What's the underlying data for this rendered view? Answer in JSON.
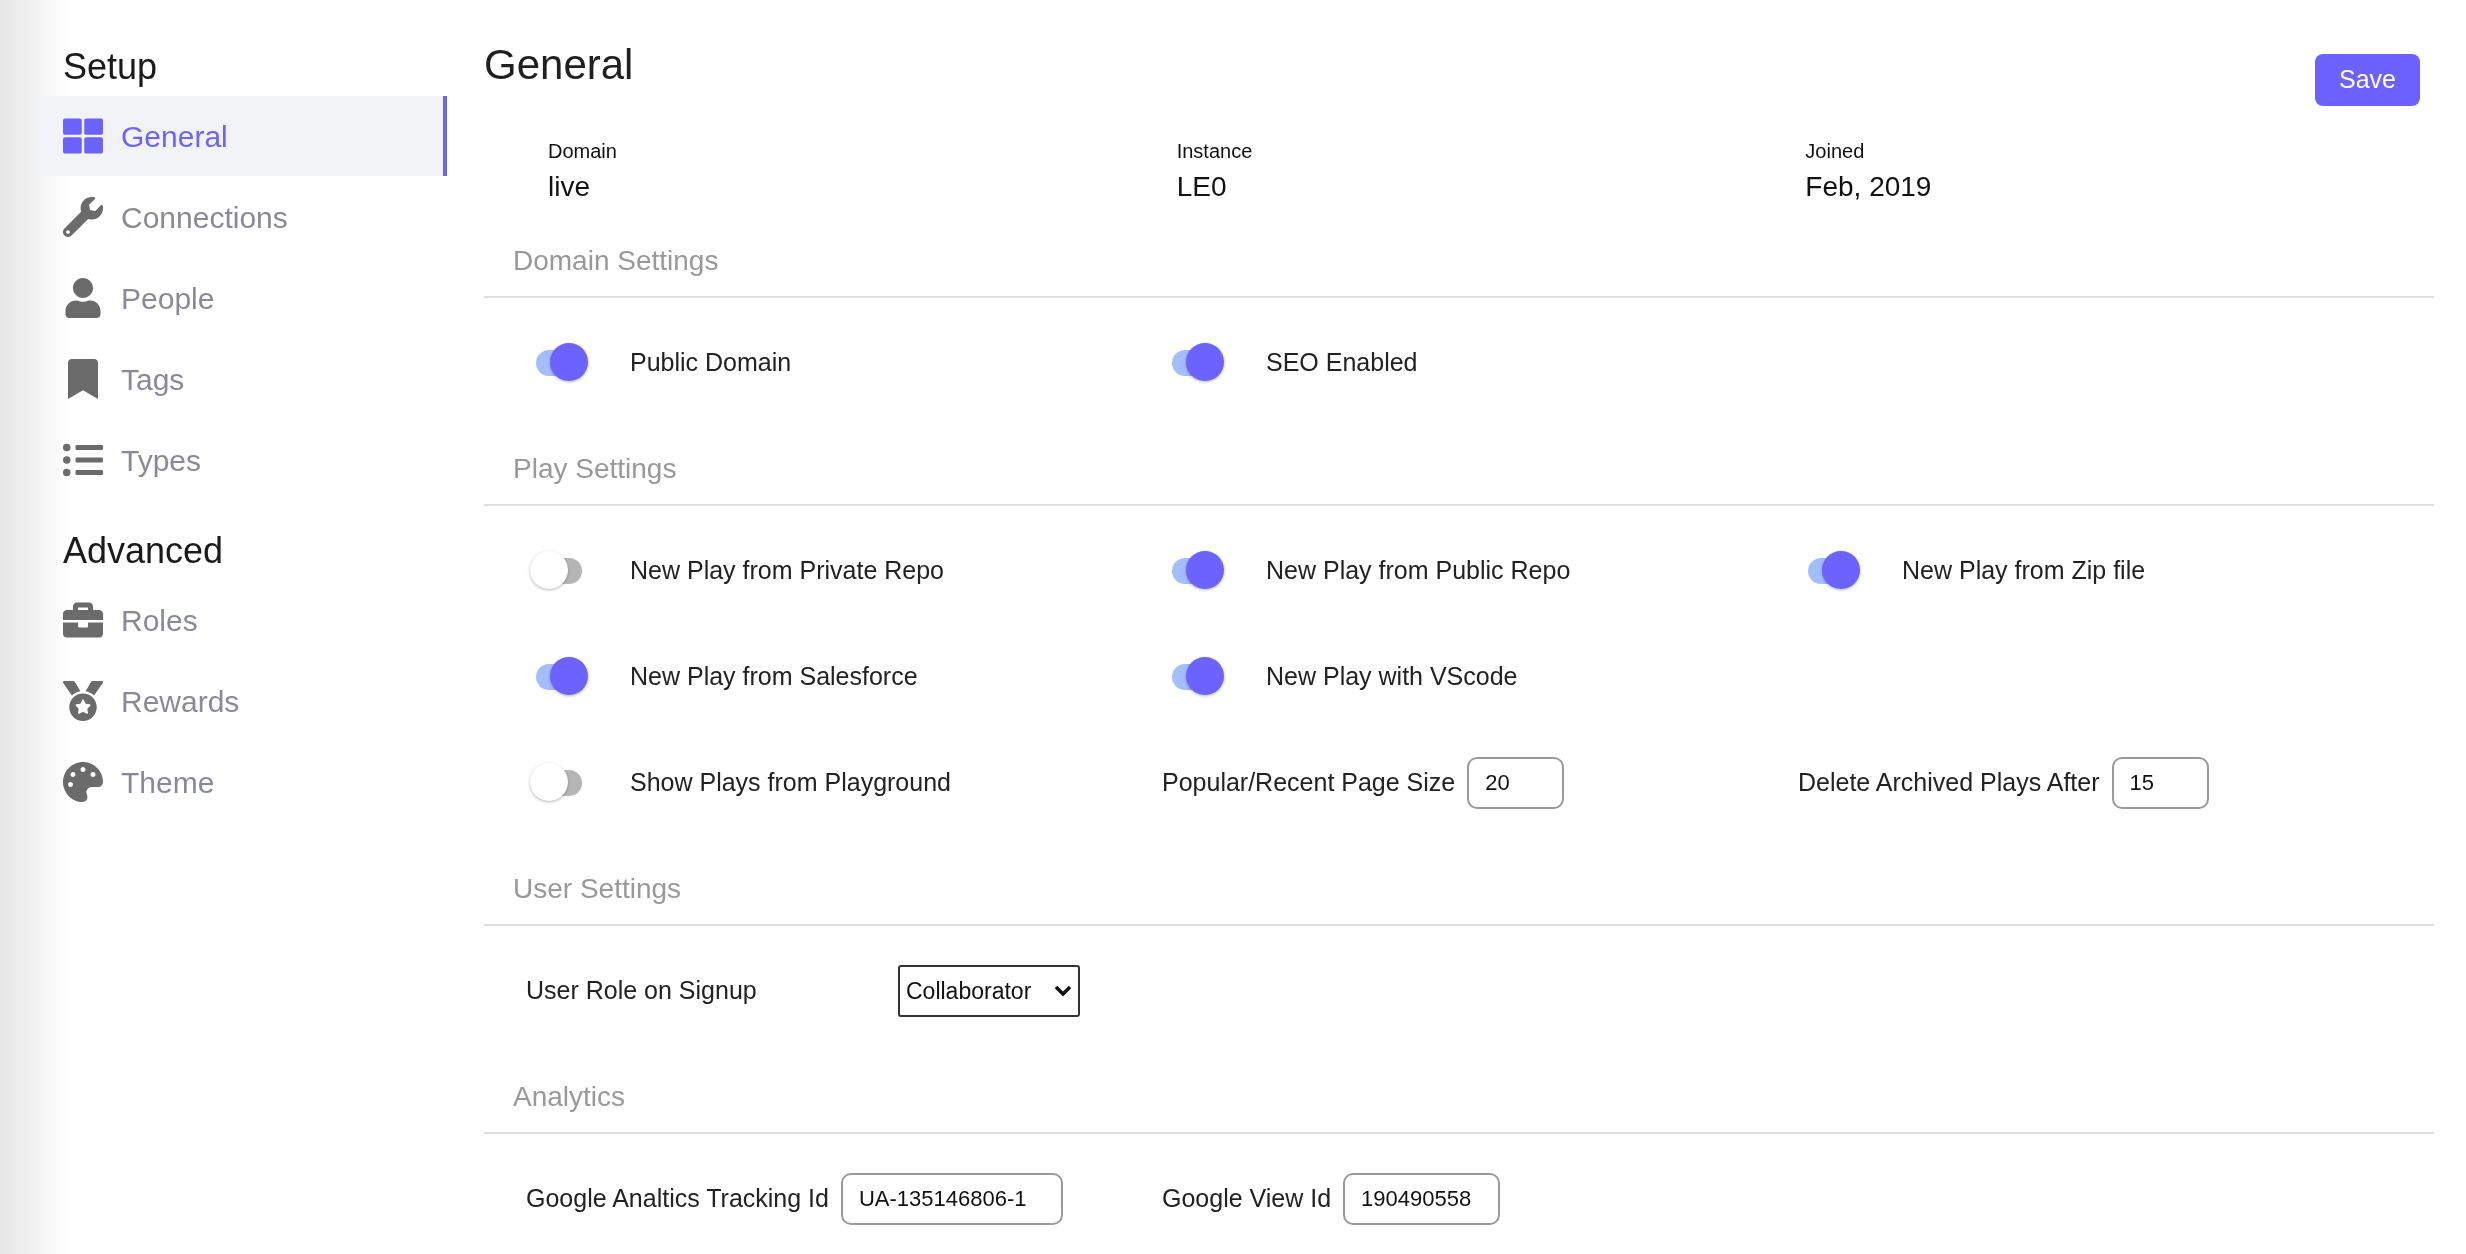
{
  "sidebar": {
    "groups": [
      {
        "title": "Setup",
        "items": [
          {
            "label": "General",
            "selected": true
          },
          {
            "label": "Connections",
            "selected": false
          },
          {
            "label": "People",
            "selected": false
          },
          {
            "label": "Tags",
            "selected": false
          },
          {
            "label": "Types",
            "selected": false
          }
        ]
      },
      {
        "title": "Advanced",
        "items": [
          {
            "label": "Roles",
            "selected": false
          },
          {
            "label": "Rewards",
            "selected": false
          },
          {
            "label": "Theme",
            "selected": false
          }
        ]
      }
    ]
  },
  "page": {
    "title": "General",
    "save_button": "Save",
    "info": [
      {
        "label": "Domain",
        "value": "live"
      },
      {
        "label": "Instance",
        "value": "LE0"
      },
      {
        "label": "Joined",
        "value": "Feb, 2019"
      }
    ]
  },
  "sections": [
    {
      "title": "Domain Settings",
      "rows": [
        [
          {
            "kind": "toggle",
            "label": "Public Domain",
            "on": true
          },
          {
            "kind": "toggle",
            "label": "SEO Enabled",
            "on": true
          }
        ]
      ]
    },
    {
      "title": "Play Settings",
      "rows": [
        [
          {
            "kind": "toggle",
            "label": "New Play from Private Repo",
            "on": false
          },
          {
            "kind": "toggle",
            "label": "New Play from Public Repo",
            "on": true
          },
          {
            "kind": "toggle",
            "label": "New Play from Zip file",
            "on": true
          }
        ],
        [
          {
            "kind": "toggle",
            "label": "New Play from Salesforce",
            "on": true
          },
          {
            "kind": "toggle",
            "label": "New Play with VScode",
            "on": true
          }
        ],
        [
          {
            "kind": "toggle",
            "label": "Show Plays from Playground",
            "on": false
          },
          {
            "kind": "field",
            "label": "Popular/Recent Page Size",
            "value": "20"
          },
          {
            "kind": "field",
            "label": "Delete Archived Plays After",
            "value": "15"
          }
        ]
      ]
    },
    {
      "title": "User Settings",
      "rows": [
        [
          {
            "kind": "select",
            "label": "User Role on Signup",
            "value": "Collaborator"
          }
        ]
      ]
    },
    {
      "title": "Analytics",
      "rows": [
        [
          {
            "kind": "field",
            "label": "Google Analtics Tracking Id",
            "value": "UA-135146806-1"
          },
          {
            "kind": "field",
            "label": "Google View Id",
            "value": "190490558"
          }
        ]
      ]
    }
  ]
}
